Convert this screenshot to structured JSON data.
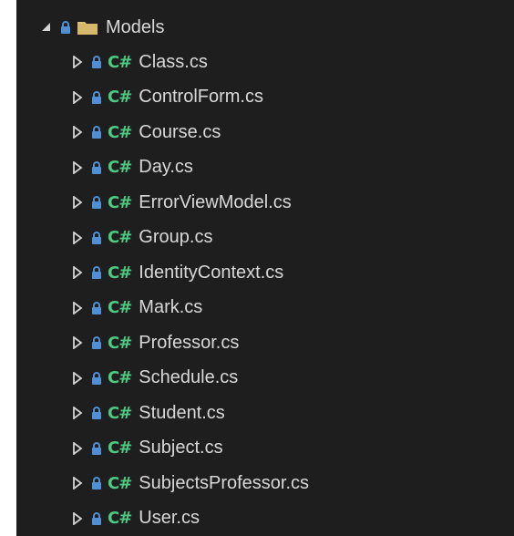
{
  "explorer": {
    "folder": {
      "name": "Models",
      "expanded": true
    },
    "file_icon_text": "C#",
    "files": [
      {
        "name": "Class.cs"
      },
      {
        "name": "ControlForm.cs"
      },
      {
        "name": "Course.cs"
      },
      {
        "name": "Day.cs"
      },
      {
        "name": "ErrorViewModel.cs"
      },
      {
        "name": "Group.cs"
      },
      {
        "name": "IdentityContext.cs"
      },
      {
        "name": "Mark.cs"
      },
      {
        "name": "Professor.cs"
      },
      {
        "name": "Schedule.cs"
      },
      {
        "name": "Student.cs"
      },
      {
        "name": "Subject.cs"
      },
      {
        "name": "SubjectsProfessor.cs"
      },
      {
        "name": "User.cs"
      }
    ]
  },
  "colors": {
    "background": "#1e1e1e",
    "lock": "#4f8fd6",
    "csharp": "#4ec981",
    "folder": "#dcc07a",
    "text": "#d8d8d8",
    "expander": "#d4d4d4"
  }
}
